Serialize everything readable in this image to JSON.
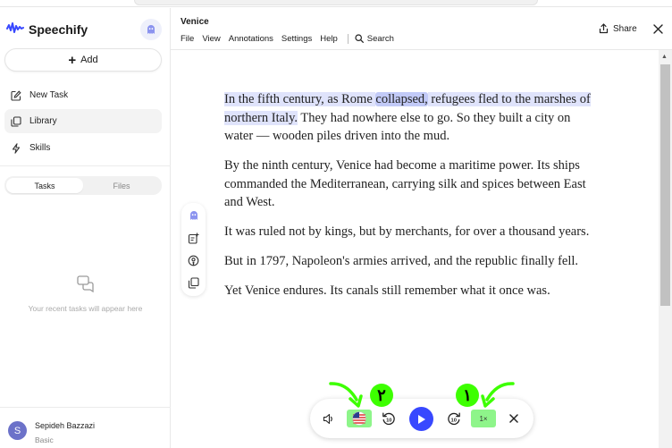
{
  "app": {
    "brand": "Speechify"
  },
  "sidebar": {
    "add_label": "Add",
    "items": [
      {
        "label": "New Task",
        "icon": "edit-icon"
      },
      {
        "label": "Library",
        "icon": "library-icon"
      },
      {
        "label": "Skills",
        "icon": "bolt-icon"
      }
    ],
    "tabs": [
      "Tasks",
      "Files"
    ],
    "empty_text": "Your recent tasks will appear here",
    "user": {
      "initial": "S",
      "name": "Sepideh Bazzazi",
      "plan": "Basic"
    }
  },
  "header": {
    "title": "Venice",
    "menu": [
      "File",
      "View",
      "Annotations",
      "Settings",
      "Help"
    ],
    "search_label": "Search",
    "share_label": "Share"
  },
  "content": {
    "p1_hl_a": "In the fifth century, as Rome",
    "p1_hl_word": "collapsed,",
    "p1_hl_b": "refugees fled to the marshes of northern Italy.",
    "p1_rest": "They had nowhere else to go. So they built a city on water — wooden piles driven into the mud.",
    "p2": "By the ninth century, Venice had become a maritime power. Its ships commanded the Mediterranean, carrying silk and spices between East and West.",
    "p3": "It was ruled not by kings, but by merchants, for over a thousand years.",
    "p4": "But in 1797, Napoleon's armies arrived, and the republic finally fell.",
    "p5": "Yet Venice endures. Its canals still remember what it once was."
  },
  "player": {
    "speed_label": "1×",
    "skip_back_label": "10",
    "skip_forward_label": "10"
  },
  "annotations": {
    "badge_voice": "٢",
    "badge_speed": "١"
  },
  "colors": {
    "accent": "#3848ff",
    "highlight_sentence": "#dfe3fb",
    "highlight_word": "#c2caf7",
    "annotation_green": "#3dff00"
  }
}
